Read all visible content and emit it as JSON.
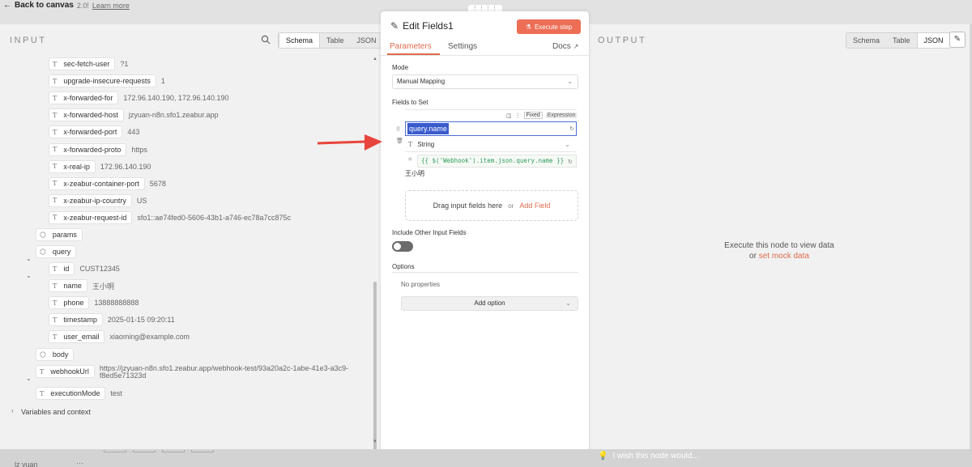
{
  "top": {
    "back_label": "Back to canvas",
    "version_text": "2.0!",
    "learn_more": "Learn more"
  },
  "input_panel": {
    "title": "INPUT",
    "view_tabs": [
      "Schema",
      "Table",
      "JSON"
    ],
    "active_tab": "Schema",
    "headers": [
      {
        "key": "sec-fetch-user",
        "value": "?1"
      },
      {
        "key": "upgrade-insecure-requests",
        "value": "1"
      },
      {
        "key": "x-forwarded-for",
        "value": "172.96.140.190, 172.96.140.190"
      },
      {
        "key": "x-forwarded-host",
        "value": "jzyuan-n8n.sfo1.zeabur.app"
      },
      {
        "key": "x-forwarded-port",
        "value": "443"
      },
      {
        "key": "x-forwarded-proto",
        "value": "https"
      },
      {
        "key": "x-real-ip",
        "value": "172.96.140.190"
      },
      {
        "key": "x-zeabur-container-port",
        "value": "5678"
      },
      {
        "key": "x-zeabur-ip-country",
        "value": "US"
      },
      {
        "key": "x-zeabur-request-id",
        "value": "sfo1::ae74fed0-5606-43b1-a746-ec78a7cc875c"
      }
    ],
    "params_label": "params",
    "query_label": "query",
    "query_fields": [
      {
        "key": "id",
        "value": "CUST12345"
      },
      {
        "key": "name",
        "value": "王小明"
      },
      {
        "key": "phone",
        "value": "13888888888"
      },
      {
        "key": "timestamp",
        "value": "2025-01-15 09:20:11"
      },
      {
        "key": "user_email",
        "value": "xiaoming@example.com"
      }
    ],
    "body_label": "body",
    "webhook_key": "webhookUrl",
    "webhook_value_line1": "https://jzyuan-n8n.sfo1.zeabur.app/webhook-test/93a20a2c-1abe-41e3-a3c9-",
    "webhook_value_line2": "f8ed5e71323d",
    "exec_key": "executionMode",
    "exec_value": "test",
    "variables_label": "Variables and context"
  },
  "modal": {
    "title": "Edit Fields1",
    "execute_label": "Execute step",
    "tabs": [
      "Parameters",
      "Settings"
    ],
    "docs_label": "Docs",
    "mode_label": "Mode",
    "mode_value": "Manual Mapping",
    "fields_label": "Fields to Set",
    "fixed_label": "Fixed",
    "expression_label": "Expression",
    "field_name": "query.name",
    "field_type": "String",
    "field_expression": "{{ $('Webhook').item.json.query.name }}",
    "field_result": "王小明",
    "drop_text": "Drag input fields here",
    "drop_or": "or",
    "add_field": "Add Field",
    "include_label": "Include Other Input Fields",
    "include_on": false,
    "options_label": "Options",
    "no_props": "No properties",
    "add_option": "Add option",
    "accent": "#ec6e55"
  },
  "output_panel": {
    "title": "OUTPUT",
    "view_tabs": [
      "Schema",
      "Table",
      "JSON"
    ],
    "active_tab": "JSON",
    "empty_line1": "Execute this node to view data",
    "empty_or": "or",
    "mock_link": "set mock data"
  },
  "footer": {
    "wish_text": "I wish this node would...",
    "user_name": "lz yuan"
  }
}
